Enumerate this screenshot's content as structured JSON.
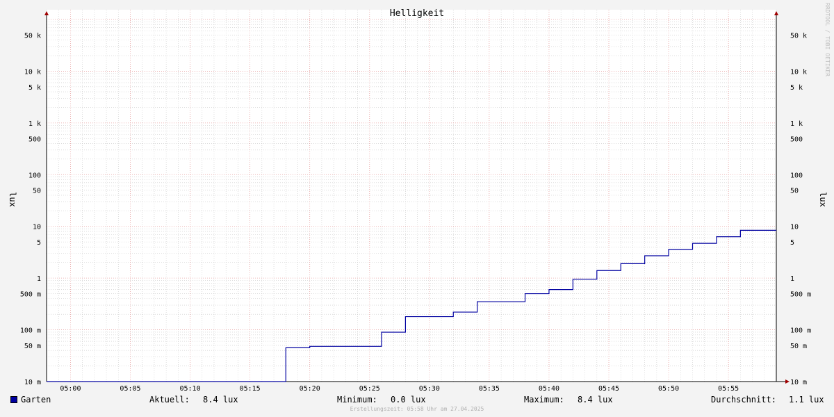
{
  "chart_data": {
    "type": "line",
    "title": "Helligkeit",
    "ylabel": "lux",
    "yscale": "log",
    "ylim": [
      0.01,
      100000
    ],
    "xlim": [
      "04:58",
      "05:59"
    ],
    "x_ticks": [
      "05:00",
      "05:05",
      "05:10",
      "05:15",
      "05:20",
      "05:25",
      "05:30",
      "05:35",
      "05:40",
      "05:45",
      "05:50",
      "05:55"
    ],
    "y_ticks": [
      {
        "value": 0.01,
        "label": "10 m"
      },
      {
        "value": 0.05,
        "label": "50 m"
      },
      {
        "value": 0.1,
        "label": "100 m"
      },
      {
        "value": 0.5,
        "label": "500 m"
      },
      {
        "value": 1,
        "label": "1"
      },
      {
        "value": 5,
        "label": "5"
      },
      {
        "value": 10,
        "label": "10"
      },
      {
        "value": 50,
        "label": "50"
      },
      {
        "value": 100,
        "label": "100"
      },
      {
        "value": 500,
        "label": "500"
      },
      {
        "value": 1000,
        "label": "1 k"
      },
      {
        "value": 5000,
        "label": "5 k"
      },
      {
        "value": 10000,
        "label": "10 k"
      },
      {
        "value": 50000,
        "label": "50 k"
      }
    ],
    "grid": true,
    "series": [
      {
        "name": "Garten",
        "color": "#0000a0",
        "step": true,
        "x": [
          "04:58",
          "05:18",
          "05:20",
          "05:26",
          "05:28",
          "05:32",
          "05:34",
          "05:38",
          "05:40",
          "05:42",
          "05:44",
          "05:46",
          "05:48",
          "05:50",
          "05:52",
          "05:54",
          "05:56",
          "05:59"
        ],
        "y": [
          0.0,
          0.045,
          0.048,
          0.09,
          0.18,
          0.22,
          0.35,
          0.5,
          0.6,
          0.95,
          1.4,
          1.9,
          2.7,
          3.6,
          4.7,
          6.3,
          8.4,
          8.4
        ]
      }
    ]
  },
  "legend": {
    "series_label": "Garten",
    "current_label": "Aktuell:",
    "current_value": "8.4 lux",
    "min_label": "Minimum:",
    "min_value": "0.0 lux",
    "max_label": "Maximum:",
    "max_value": "8.4 lux",
    "avg_label": "Durchschnitt:",
    "avg_value": "1.1 lux"
  },
  "footer": "Erstellungszeit: 05:58 Uhr am 27.04.2025",
  "watermark": "RRDTOOL / TOBI OETIKER",
  "colors": {
    "line": "#0000a0",
    "major_grid": "#e8a0a0",
    "minor_grid": "#c8c8c8",
    "axis": "#000000",
    "background": "#f3f3f3",
    "plot": "#ffffff"
  }
}
